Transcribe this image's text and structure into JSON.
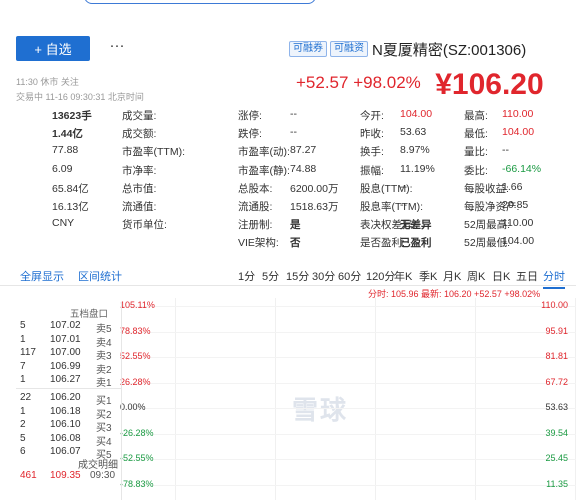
{
  "header": {
    "add_label": "+ 自选",
    "more_label": "···",
    "stock_name": "N夏厦精密(SZ:001306)",
    "tags": [
      "可融资",
      "可融券",
      "可转债"
    ],
    "meta_status": "11:30 休市 关注",
    "meta_time": "交易中 11-16 09:30:31 北京时间",
    "price": "¥106.20",
    "change": "+52.57 +98.02%"
  },
  "quote_rows": [
    [
      [
        "最高:",
        "110.00",
        "up"
      ],
      [
        "今开:",
        "104.00",
        "up"
      ],
      [
        "涨停:",
        "--",
        ""
      ],
      [
        "成交量:",
        "13623手",
        "bold"
      ]
    ],
    [
      [
        "最低:",
        "104.00",
        "up"
      ],
      [
        "昨收:",
        "53.63",
        ""
      ],
      [
        "跌停:",
        "--",
        ""
      ],
      [
        "成交额:",
        "1.44亿",
        "bold"
      ]
    ],
    [
      [
        "量比:",
        "--",
        ""
      ],
      [
        "换手:",
        "8.97%",
        ""
      ],
      [
        "市盈率(动):",
        "87.27",
        ""
      ],
      [
        "市盈率(TTM):",
        "77.88",
        ""
      ]
    ],
    [
      [
        "委比:",
        "-66.14%",
        "down"
      ],
      [
        "振幅:",
        "11.19%",
        ""
      ],
      [
        "市盈率(静):",
        "74.88",
        ""
      ],
      [
        "市净率:",
        "6.09",
        ""
      ]
    ],
    [
      [
        "每股收益:",
        "1.66",
        ""
      ],
      [
        "股息(TTM):",
        "--",
        ""
      ],
      [
        "总股本:",
        "6200.00万",
        ""
      ],
      [
        "总市值:",
        "65.84亿",
        ""
      ]
    ],
    [
      [
        "每股净资产:",
        "20.85",
        ""
      ],
      [
        "股息率(TTM):",
        "--",
        ""
      ],
      [
        "流通股:",
        "1518.63万",
        ""
      ],
      [
        "流通值:",
        "16.13亿",
        ""
      ]
    ],
    [
      [
        "52周最高:",
        "110.00",
        ""
      ],
      [
        "表决权差异:",
        "无差异",
        "bold"
      ],
      [
        "注册制:",
        "是",
        "bold"
      ],
      [
        "货币单位:",
        "CNY",
        ""
      ]
    ],
    [
      [
        "52周最低:",
        "104.00",
        ""
      ],
      [
        "是否盈利:",
        "已盈利",
        "bold"
      ],
      [
        "VIE架构:",
        "否",
        "bold"
      ],
      [
        "",
        "",
        ""
      ]
    ]
  ],
  "tabs": {
    "periods": [
      "分时",
      "五日",
      "日K",
      "周K",
      "月K",
      "季K",
      "年K",
      "120分",
      "60分",
      "30分",
      "15分",
      "5分",
      "1分"
    ],
    "links": [
      "区间统计",
      "全屏显示"
    ],
    "active": "分时"
  },
  "legend_line": "分时: 105.96 最新: 106.20 +52.57 +98.02%",
  "chart_data": {
    "type": "line",
    "ylabel_left": [
      "110.00",
      "95.91",
      "81.81",
      "67.72",
      "53.63",
      "39.54",
      "25.45",
      "11.35"
    ],
    "ylabel_right": [
      "105.11%",
      "78.83%",
      "52.55%",
      "26.28%",
      "0.00%",
      "-26.28%",
      "-52.55%",
      "-78.83%"
    ],
    "watermark": "雪球"
  },
  "order_book": {
    "title": "五档盘口",
    "asks": [
      {
        "label": "卖5",
        "price": "107.02",
        "vol": "5"
      },
      {
        "label": "卖4",
        "price": "107.01",
        "vol": "1"
      },
      {
        "label": "卖3",
        "price": "107.00",
        "vol": "117"
      },
      {
        "label": "卖2",
        "price": "106.99",
        "vol": "7"
      },
      {
        "label": "卖1",
        "price": "106.27",
        "vol": "1"
      }
    ],
    "bids": [
      {
        "label": "买1",
        "price": "106.20",
        "vol": "22"
      },
      {
        "label": "买2",
        "price": "106.18",
        "vol": "1"
      },
      {
        "label": "买3",
        "price": "106.10",
        "vol": "2"
      },
      {
        "label": "买4",
        "price": "106.08",
        "vol": "5"
      },
      {
        "label": "买5",
        "price": "106.07",
        "vol": "6"
      }
    ],
    "footer_title": "成交明细",
    "last_trade": {
      "time": "09:30",
      "price": "109.35",
      "vol": "461"
    }
  },
  "colors": {
    "up": "#e0262d",
    "down": "#1a9a42",
    "accent": "#1f6fd1"
  }
}
